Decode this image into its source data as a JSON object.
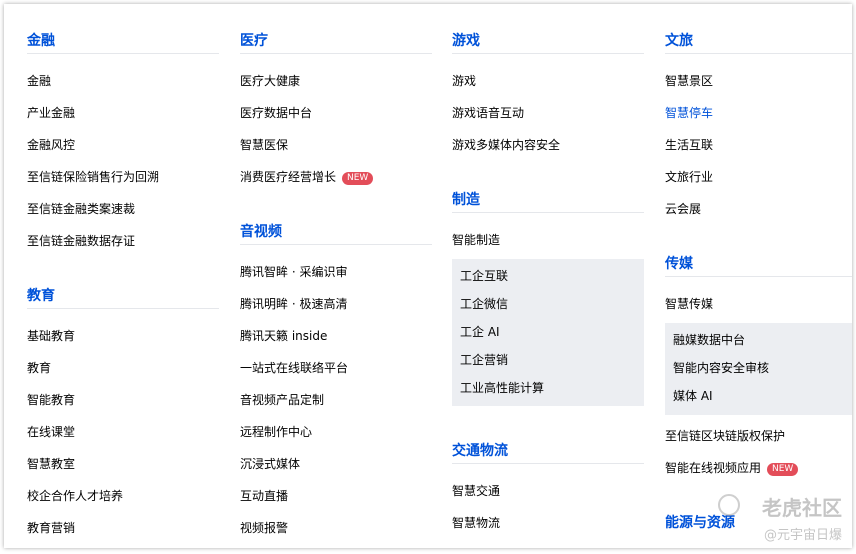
{
  "columns": [
    {
      "sections": [
        {
          "title": "金融",
          "items": [
            "金融",
            "产业金融",
            "金融风控",
            "至信链保险销售行为回溯",
            "至信链金融类案速裁",
            "至信链金融数据存证"
          ]
        },
        {
          "title": "教育",
          "items": [
            "基础教育",
            "教育",
            "智能教育",
            "在线课堂",
            "智慧教室",
            "校企合作人才培养",
            "教育营销"
          ]
        }
      ]
    },
    {
      "sections": [
        {
          "title": "医疗",
          "items": [
            "医疗大健康",
            "医疗数据中台",
            "智慧医保",
            "消费医疗经营增长"
          ],
          "badge_item_index": 3,
          "badge": "NEW"
        },
        {
          "title": "音视频",
          "items": [
            "腾讯智眸 · 采编识审",
            "腾讯明眸 · 极速高清",
            "腾讯天籁 inside",
            "一站式在线联络平台",
            "音视频产品定制",
            "远程制作中心",
            "沉浸式媒体",
            "互动直播",
            "视频报警"
          ]
        }
      ]
    },
    {
      "sections": [
        {
          "title": "游戏",
          "items": [
            "游戏",
            "游戏语音互动",
            "游戏多媒体内容安全"
          ]
        },
        {
          "title": "制造",
          "items": [
            "智能制造"
          ],
          "sub_items": [
            "工企互联",
            "工企微信",
            "工企 AI",
            "工企营销",
            "工业高性能计算"
          ]
        },
        {
          "title": "交通物流",
          "items": [
            "智慧交通",
            "智慧物流"
          ]
        }
      ]
    },
    {
      "sections": [
        {
          "title": "文旅",
          "items": [
            "智慧景区",
            "智慧停车",
            "生活互联",
            "文旅行业",
            "云会展"
          ],
          "active_item_index": 1
        },
        {
          "title": "传媒",
          "items": [
            "智慧传媒"
          ],
          "sub_items": [
            "融媒数据中台",
            "智能内容安全审核",
            "媒体 AI"
          ],
          "after_items": [
            "至信链区块链版权保护",
            "智能在线视频应用"
          ],
          "badge": "NEW"
        },
        {
          "title": "能源与资源",
          "items": []
        }
      ]
    }
  ],
  "watermark": {
    "line1": "老虎社区",
    "line2": "@元宇宙日爆"
  },
  "colors": {
    "accent": "#0052d9",
    "badge": "#e34d59",
    "subbox": "#eceef2"
  }
}
